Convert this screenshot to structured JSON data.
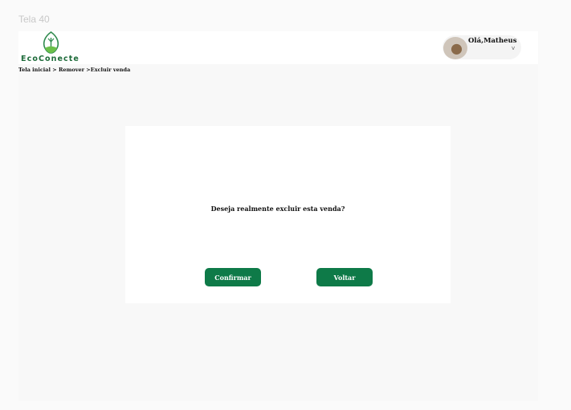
{
  "frame": {
    "label": "Tela 40"
  },
  "brand": {
    "name": "EcoConecte",
    "color": "#1e6b3a",
    "icon": "leaf-icon"
  },
  "user": {
    "greeting": "Olá,Matheus",
    "chevron": "v"
  },
  "breadcrumb": {
    "home": "Tela inicial ",
    "sep1": ">",
    "remove": "Remover ",
    "sep2": ">",
    "current": "Excluir venda"
  },
  "dialog": {
    "question": "Deseja realmente excluir esta venda?",
    "confirm_label": "Confirmar",
    "back_label": "Voltar"
  },
  "colors": {
    "accent": "#0e7a48",
    "background": "#fafafa"
  }
}
